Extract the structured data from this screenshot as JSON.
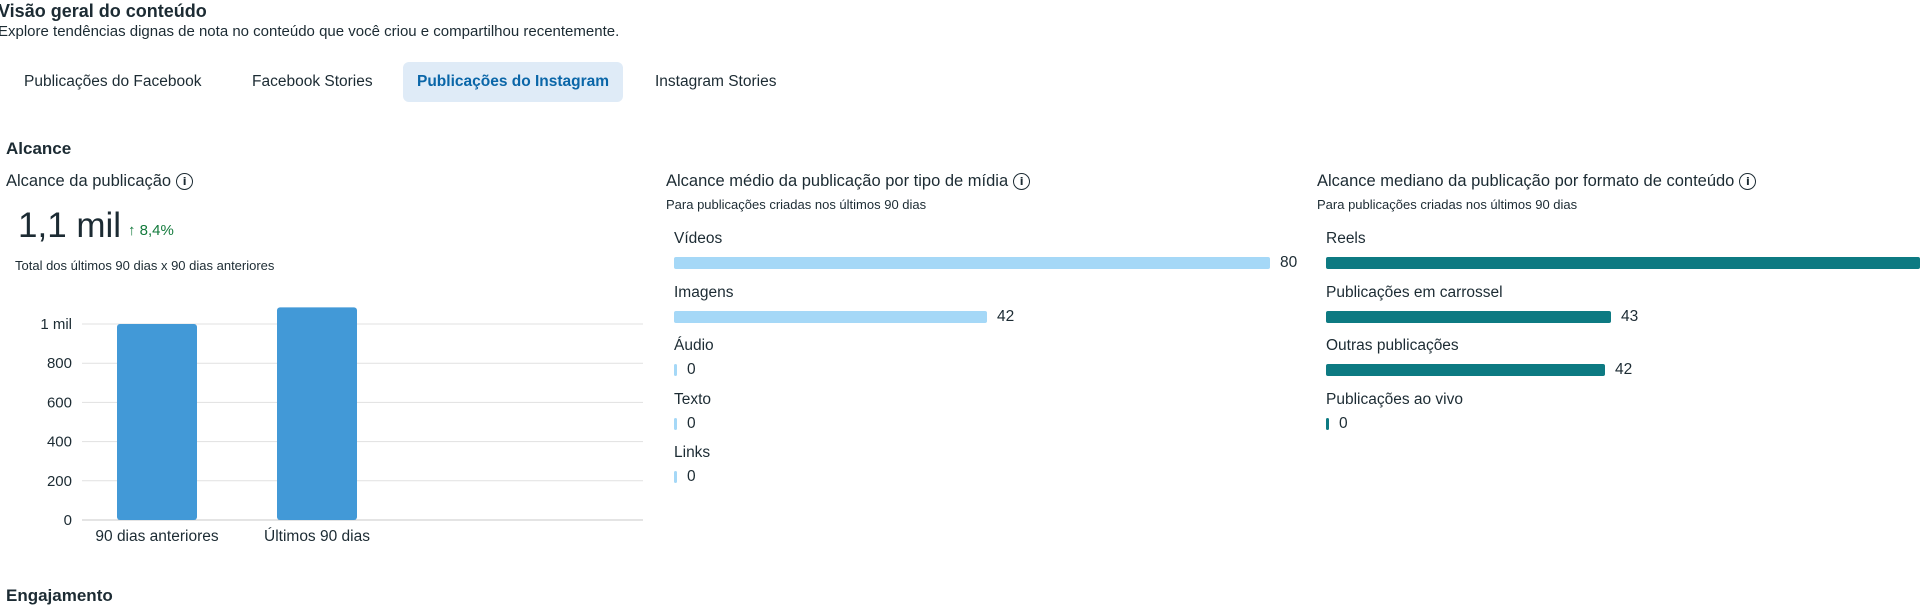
{
  "header": {
    "title": "Visão geral do conteúdo",
    "subtitle": "Explore tendências dignas de nota no conteúdo que você criou e compartilhou recentemente."
  },
  "tabs": [
    {
      "label": "Publicações do Facebook",
      "active": false
    },
    {
      "label": "Facebook Stories",
      "active": false
    },
    {
      "label": "Publicações do Instagram",
      "active": true
    },
    {
      "label": "Instagram Stories",
      "active": false
    }
  ],
  "reach_section": {
    "heading": "Alcance",
    "post_reach": {
      "title": "Alcance da publicação",
      "value": "1,1 mil",
      "delta": "↑ 8,4%",
      "caption": "Total dos últimos 90 dias x 90 dias anteriores"
    }
  },
  "chart_data": [
    {
      "type": "bar",
      "title": "",
      "categories": [
        "90 dias anteriores",
        "Últimos 90 dias"
      ],
      "values": [
        1000,
        1085
      ],
      "ylim": [
        0,
        1000
      ],
      "yticks": [
        0,
        200,
        400,
        600,
        800,
        1000
      ],
      "ytick_labels": [
        "0",
        "200",
        "400",
        "600",
        "800",
        "1 mil"
      ],
      "grid": true,
      "color": "#4299d7"
    },
    {
      "type": "bar",
      "orientation": "horizontal",
      "title": "Alcance médio da publicação por tipo de mídia",
      "subtitle": "Para publicações criadas nos últimos 90 dias",
      "categories": [
        "Vídeos",
        "Imagens",
        "Áudio",
        "Texto",
        "Links"
      ],
      "values": [
        80,
        42,
        0,
        0,
        0
      ],
      "max": 80,
      "color": "#a5d8f7"
    },
    {
      "type": "bar",
      "orientation": "horizontal",
      "title": "Alcance mediano da publicação por formato de conteúdo",
      "subtitle": "Para publicações criadas nos últimos 90 dias",
      "categories": [
        "Reels",
        "Publicações em carrossel",
        "Outras publicações",
        "Publicações ao vivo"
      ],
      "values": [
        null,
        43,
        42,
        0
      ],
      "value_labels": [
        "",
        "43",
        "42",
        "0"
      ],
      "fill_fractions": [
        1.0,
        0.48,
        0.47,
        0.0
      ],
      "color": "#0d7a82"
    }
  ],
  "next_section": {
    "heading": "Engajamento"
  }
}
